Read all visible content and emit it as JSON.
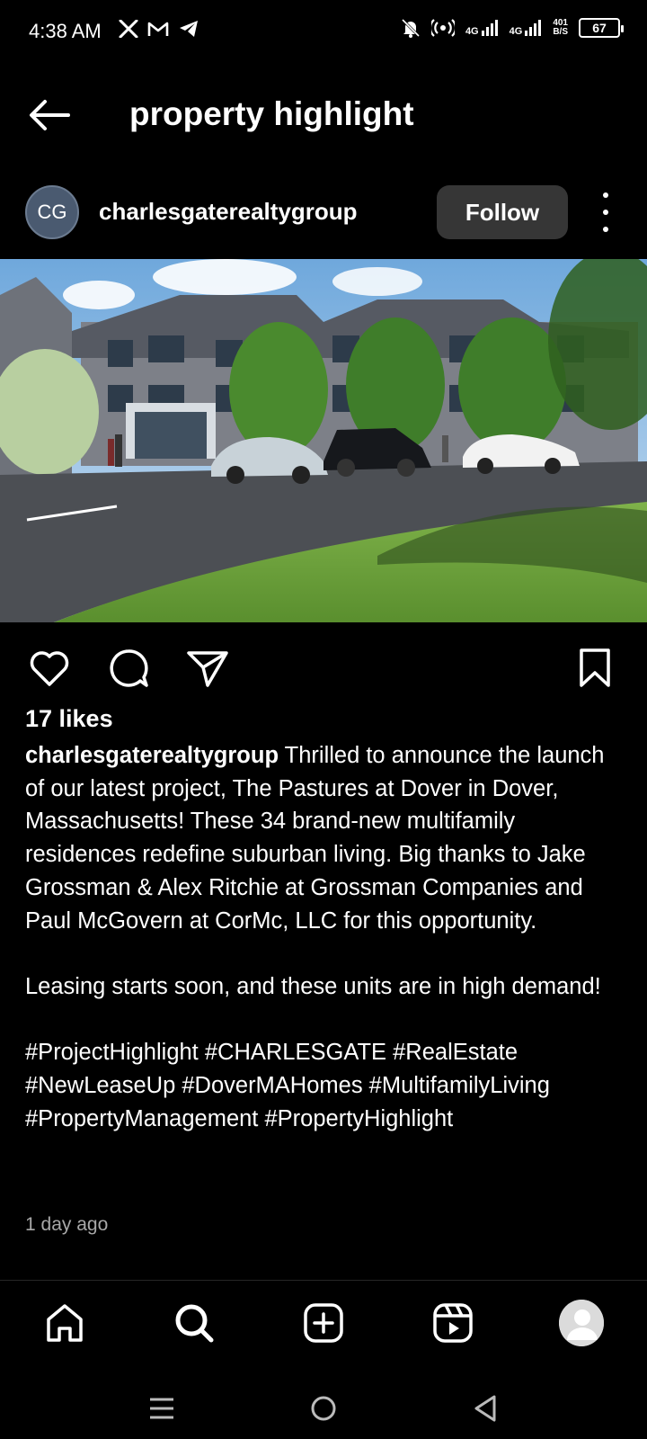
{
  "status_bar": {
    "time": "4:38 AM",
    "left_icons": [
      "x-icon",
      "gmail-icon",
      "telegram-icon"
    ],
    "network_1": "4G",
    "network_2": "4G",
    "speed_value": "401",
    "speed_unit": "B/S",
    "battery": "67"
  },
  "header": {
    "title": "property highlight"
  },
  "post": {
    "author_initials": "CG",
    "author": "charlesgaterealtygroup",
    "follow_label": "Follow",
    "likes": "17 likes",
    "caption_user": "charlesgaterealtygroup",
    "caption_p1": "Thrilled to announce the launch of our latest project, The Pastures at Dover in Dover, Massachusetts! These 34 brand-new multifamily residences redefine suburban living. Big thanks to Jake Grossman & Alex Ritchie at Grossman Companies and Paul McGovern at CorMc, LLC for this opportunity.",
    "caption_p2": "Leasing starts soon, and these units are in high demand!",
    "caption_tags": "#ProjectHighlight #CHARLESGATE #RealEstate #NewLeaseUp #DoverMAHomes #MultifamilyLiving #PropertyManagement #PropertyHighlight",
    "time_ago": "1 day ago"
  },
  "bottom_nav": [
    "home-icon",
    "search-icon",
    "create-icon",
    "reels-icon",
    "profile-avatar"
  ],
  "colors": {
    "background": "#000000",
    "follow_bg": "#363636",
    "secondary_text": "#a8a8a8"
  }
}
